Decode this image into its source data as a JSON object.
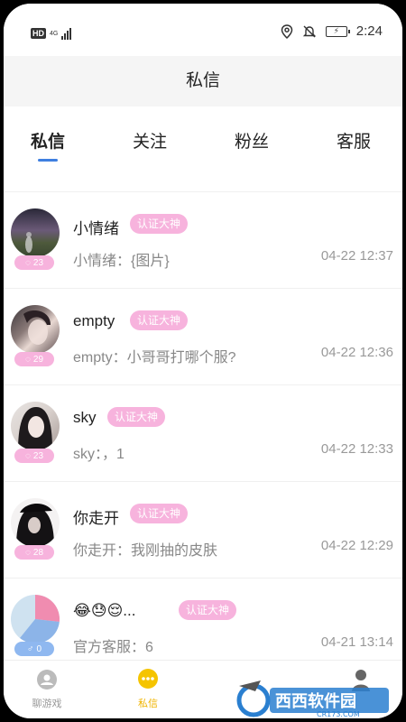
{
  "status_bar": {
    "hd": "HD",
    "network": "4G",
    "time": "2:24"
  },
  "header": {
    "title": "私信"
  },
  "tabs": [
    {
      "label": "私信",
      "active": true
    },
    {
      "label": "关注",
      "active": false
    },
    {
      "label": "粉丝",
      "active": false
    },
    {
      "label": "客服",
      "active": false
    }
  ],
  "messages": [
    {
      "name": "小情绪",
      "badge_label": "认证大神",
      "preview": "小情绪：{图片}",
      "time": "04-22 12:37",
      "count": "23",
      "badge_type": "female"
    },
    {
      "name": "empty",
      "badge_label": "认证大神",
      "preview": "empty：小哥哥打哪个服?",
      "time": "04-22 12:36",
      "count": "29",
      "badge_type": "female"
    },
    {
      "name": "sky",
      "badge_label": "认证大神",
      "preview": "sky：，1",
      "time": "04-22 12:33",
      "count": "23",
      "badge_type": "female"
    },
    {
      "name": "你走开",
      "badge_label": "认证大神",
      "preview": "你走开：我刚抽的皮肤",
      "time": "04-22 12:29",
      "count": "28",
      "badge_type": "female"
    },
    {
      "name": "😂😓😌...",
      "badge_label": "认证大神",
      "preview": "官方客服：6",
      "time": "04-21 13:14",
      "count": "0",
      "badge_type": "male"
    }
  ],
  "bottom_nav": [
    {
      "label": "聊游戏",
      "active": false,
      "icon": "group-chat-icon"
    },
    {
      "label": "私信",
      "active": true,
      "icon": "message-bubble-icon"
    },
    {
      "label": "",
      "active": false,
      "icon": "profile-icon"
    }
  ],
  "watermark": {
    "text": "西西软件园",
    "sub": "CR173.COM"
  },
  "colors": {
    "accent_blue": "#3f7fe0",
    "pink_badge": "#f7b3dd",
    "active_nav": "#f0b400"
  }
}
